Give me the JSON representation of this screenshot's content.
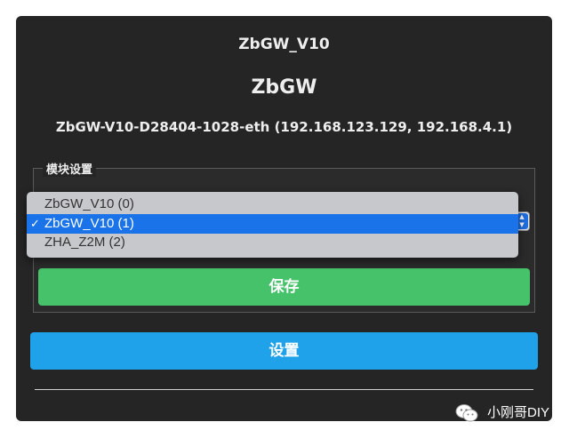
{
  "header": {
    "device_title": "ZbGW_V10",
    "app_name": "ZbGW",
    "device_info": "ZbGW-V10-D28404-1028-eth (192.168.123.129, 192.168.4.1)"
  },
  "module_settings": {
    "legend": "模块设置",
    "select": {
      "selected_index": 1,
      "options": [
        "ZbGW_V10 (0)",
        "ZbGW_V10 (1)",
        "ZHA_Z2M (2)"
      ]
    },
    "check_mark": "✓",
    "save_label": "保存"
  },
  "settings_label": "设置",
  "watermark": {
    "icon": "wechat-icon",
    "text": "小刚哥DIY"
  },
  "colors": {
    "panel_bg": "#252525",
    "save_button": "#45c26a",
    "settings_button": "#1fa2ea",
    "selected_option": "#1a73e8"
  }
}
